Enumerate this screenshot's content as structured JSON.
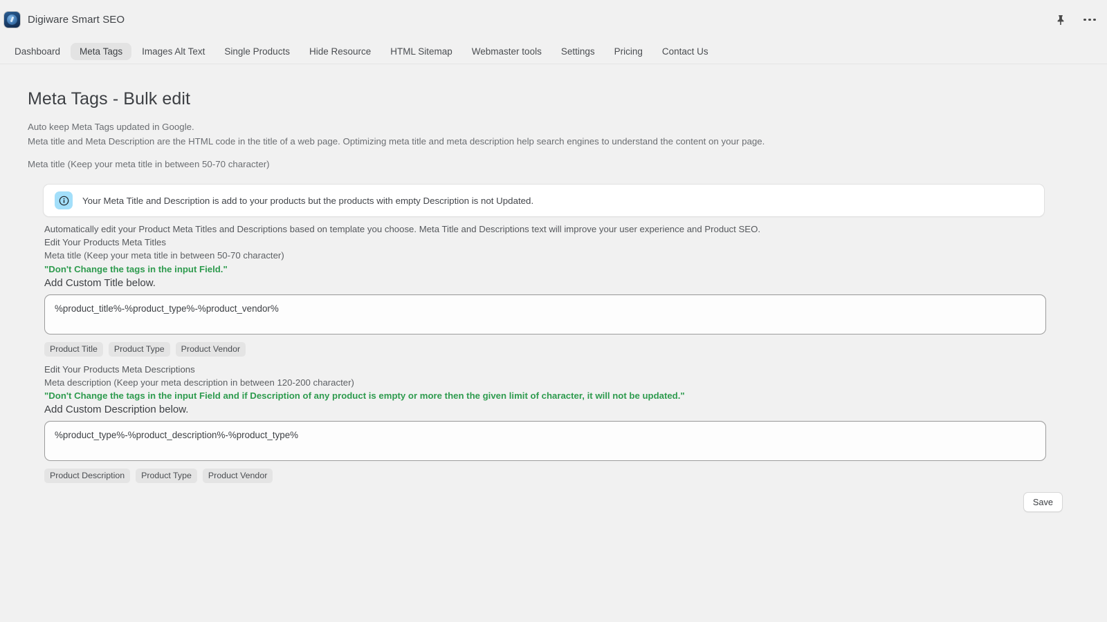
{
  "app": {
    "title": "Digiware Smart SEO",
    "logo_icon": "seo-globe-icon",
    "pin_icon": "pin-icon",
    "overflow_icon": "more-horizontal-icon"
  },
  "nav": {
    "items": [
      {
        "label": "Dashboard",
        "active": false
      },
      {
        "label": "Meta Tags",
        "active": true
      },
      {
        "label": "Images Alt Text",
        "active": false
      },
      {
        "label": "Single Products",
        "active": false
      },
      {
        "label": "Hide Resource",
        "active": false
      },
      {
        "label": "HTML Sitemap",
        "active": false
      },
      {
        "label": "Webmaster tools",
        "active": false
      },
      {
        "label": "Settings",
        "active": false
      },
      {
        "label": "Pricing",
        "active": false
      },
      {
        "label": "Contact Us",
        "active": false
      }
    ]
  },
  "page": {
    "title": "Meta Tags - Bulk edit",
    "lead_line1": "Auto keep Meta Tags updated in Google.",
    "lead_line2": "Meta title and Meta Description are the HTML code in the title of a web page. Optimizing meta title and meta description help search engines to understand the content on your page.",
    "lead_line3": "Meta title (Keep your meta title in between 50-70 character)"
  },
  "banner": {
    "icon": "info-circle-icon",
    "message": "Your Meta Title and Description is add to your products but the products with empty Description is not Updated."
  },
  "intro": {
    "description": "Automatically edit your Product Meta Titles and Descriptions based on template you choose. Meta Title and Descriptions text will improve your user experience and Product SEO."
  },
  "title_section": {
    "heading": "Edit Your Products Meta Titles",
    "hint": "Meta title (Keep your meta title in between 50-70 character)",
    "warning": "\"Don't Change the tags in the input Field.\"",
    "field_label": "Add Custom Title below.",
    "field_value": "%product_title%-%product_type%-%product_vendor%",
    "field_placeholder": "%product_title%-%product_type%-%product_vendor%",
    "chips": [
      "Product Title",
      "Product Type",
      "Product Vendor"
    ]
  },
  "description_section": {
    "heading": "Edit Your Products Meta Descriptions",
    "hint": "Meta description (Keep your meta description in between 120-200 character)",
    "warning": "\"Don't Change the tags in the input Field and if Description of any product is empty or more then the given limit of character, it will not be updated.\"",
    "field_label": "Add Custom Description below.",
    "field_value": "%product_type%-%product_description%-%product_type%",
    "field_placeholder": "%product_type%-%product_description%-%product_type%",
    "chips": [
      "Product Description",
      "Product Type",
      "Product Vendor"
    ]
  },
  "actions": {
    "save_label": "Save"
  },
  "colors": {
    "page_bg": "#F1F1F1",
    "accent_green": "#2E9B4E",
    "banner_icon_bg": "#A3DFFA",
    "active_tab_bg": "#E3E3E3",
    "chip_bg": "#E4E4E4"
  }
}
